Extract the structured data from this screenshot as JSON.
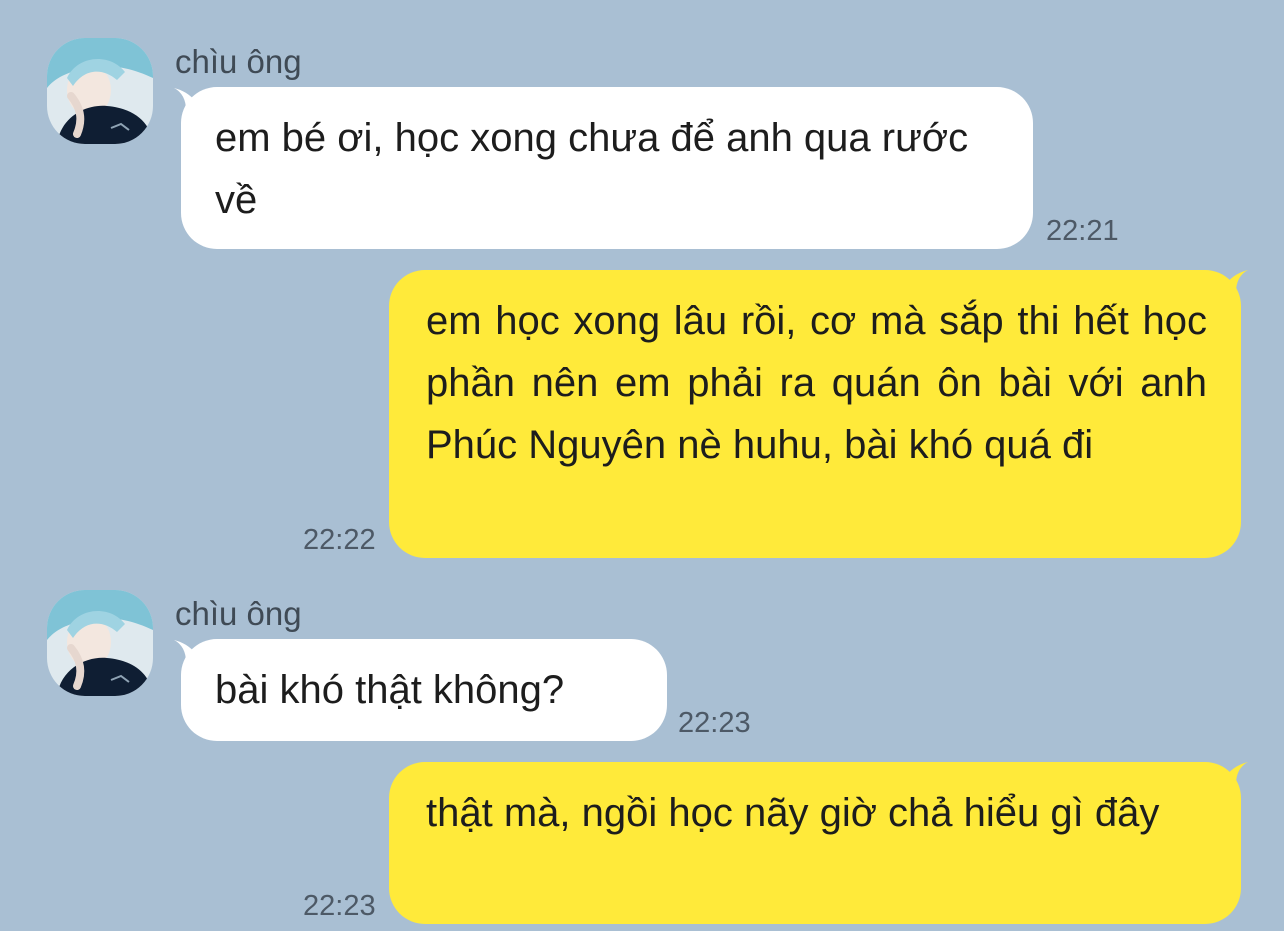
{
  "colors": {
    "background": "#a9bfd3",
    "incoming_bubble": "#ffffff",
    "outgoing_bubble": "#ffea3a"
  },
  "messages": [
    {
      "direction": "incoming",
      "sender": "chìu ông",
      "text": "em bé ơi, học xong chưa để anh qua rước về",
      "time": "22:21"
    },
    {
      "direction": "outgoing",
      "text": "em học xong lâu rồi, cơ mà sắp thi hết học phần nên em phải ra quán ôn bài với anh Phúc Nguyên nè huhu, bài khó quá đi",
      "time": "22:22"
    },
    {
      "direction": "incoming",
      "sender": "chìu ông",
      "text": "bài khó thật không?",
      "time": "22:23"
    },
    {
      "direction": "outgoing",
      "text": "thật mà, ngồi học nãy giờ chả hiểu gì đây",
      "time": "22:23"
    }
  ]
}
